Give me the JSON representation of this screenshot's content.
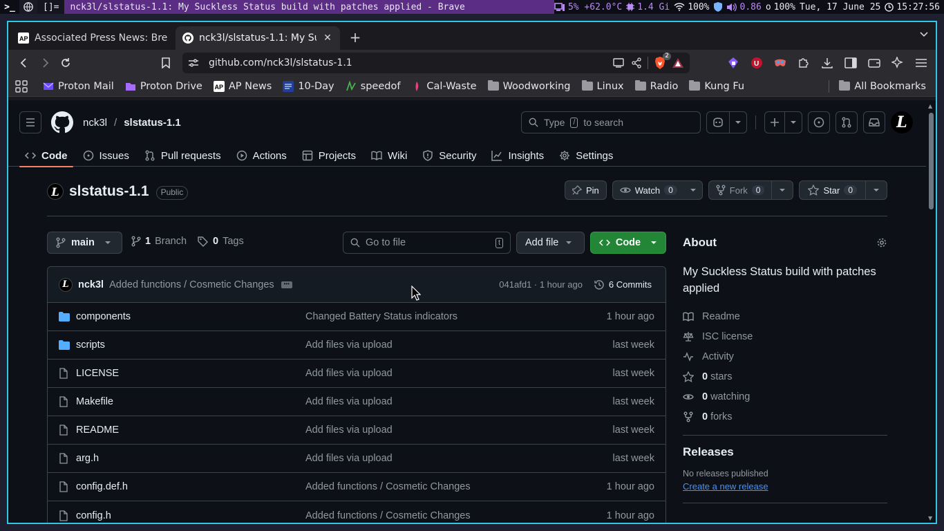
{
  "wm": {
    "terminal_icon": ">_",
    "layout": "[]=",
    "window_title": "nck3l/slstatus-1.1: My Suckless Status build with patches applied - Brave",
    "cpu": "5% +62.0°C",
    "ram": "1.4 Gi",
    "wifi": "100%",
    "volume": "0.86",
    "brightness": "100%",
    "brightness_icon": "o",
    "date": "Tue, 17 June 25",
    "time": "15:27:56"
  },
  "tabs": [
    {
      "title": "Associated Press News: Bre",
      "favicon": "ap-news-icon"
    },
    {
      "title": "nck3l/slstatus-1.1: My Su",
      "favicon": "github-icon",
      "active": true
    }
  ],
  "url": "github.com/nck3l/slstatus-1.1",
  "brave_shield_badge": "2",
  "bookmarks": [
    {
      "label": "Proton Mail",
      "icon": "proton-mail-icon",
      "color": "#6d4aff"
    },
    {
      "label": "Proton Drive",
      "icon": "proton-drive-icon",
      "color": "#a66bff"
    },
    {
      "label": "AP News",
      "icon": "ap-icon",
      "color": "#ffffff"
    },
    {
      "label": "10-Day",
      "icon": "weather-channel-icon",
      "color": "#1f3f9b"
    },
    {
      "label": "speedof",
      "icon": "speedof-icon",
      "color": "#4caf50"
    },
    {
      "label": "Cal-Waste",
      "icon": "cal-waste-icon",
      "color": "#e0457b"
    },
    {
      "label": "Woodworking",
      "icon": "folder-icon"
    },
    {
      "label": "Linux",
      "icon": "folder-icon"
    },
    {
      "label": "Radio",
      "icon": "folder-icon"
    },
    {
      "label": "Kung Fu",
      "icon": "folder-icon"
    }
  ],
  "all_bookmarks": "All Bookmarks",
  "gh": {
    "owner": "nck3l",
    "separator": "/",
    "repo": "slstatus-1.1",
    "search_prefix": "Type",
    "search_key": "/",
    "search_suffix": "to search",
    "avatar_letter": "L",
    "nav": [
      {
        "label": "Code",
        "icon": "code-icon",
        "active": true
      },
      {
        "label": "Issues",
        "icon": "issue-icon"
      },
      {
        "label": "Pull requests",
        "icon": "pull-request-icon"
      },
      {
        "label": "Actions",
        "icon": "play-icon"
      },
      {
        "label": "Projects",
        "icon": "table-icon"
      },
      {
        "label": "Wiki",
        "icon": "book-icon"
      },
      {
        "label": "Security",
        "icon": "shield-icon"
      },
      {
        "label": "Insights",
        "icon": "graph-icon"
      },
      {
        "label": "Settings",
        "icon": "gear-icon"
      }
    ],
    "repo_title": "slstatus-1.1",
    "visibility": "Public",
    "pin": "Pin",
    "watch": "Watch",
    "watch_count": "0",
    "fork": "Fork",
    "fork_count": "0",
    "star": "Star",
    "star_count": "0",
    "branch": "main",
    "branch_count": "1",
    "branch_label": "Branch",
    "tag_count": "0",
    "tag_label": "Tags",
    "goto_placeholder": "Go to file",
    "goto_key": "t",
    "add_file": "Add file",
    "code_btn": "Code",
    "commit": {
      "author": "nck3l",
      "message": "Added functions / Cosmetic Changes",
      "meta": "041afd1 · 1 hour ago",
      "count_label": "6 Commits"
    },
    "files": [
      {
        "name": "components",
        "type": "dir",
        "msg": "Changed Battery Status indicators",
        "time": "1 hour ago"
      },
      {
        "name": "scripts",
        "type": "dir",
        "msg": "Add files via upload",
        "time": "last week"
      },
      {
        "name": "LICENSE",
        "type": "file",
        "msg": "Add files via upload",
        "time": "last week"
      },
      {
        "name": "Makefile",
        "type": "file",
        "msg": "Add files via upload",
        "time": "last week"
      },
      {
        "name": "README",
        "type": "file",
        "msg": "Add files via upload",
        "time": "last week"
      },
      {
        "name": "arg.h",
        "type": "file",
        "msg": "Add files via upload",
        "time": "last week"
      },
      {
        "name": "config.def.h",
        "type": "file",
        "msg": "Added functions / Cosmetic Changes",
        "time": "1 hour ago"
      },
      {
        "name": "config.h",
        "type": "file",
        "msg": "Added functions / Cosmetic Changes",
        "time": "1 hour ago"
      }
    ],
    "about": {
      "title": "About",
      "description": "My Suckless Status build with patches applied",
      "readme": "Readme",
      "license": "ISC license",
      "activity": "Activity",
      "stars_count": "0",
      "stars_label": "stars",
      "watching_count": "0",
      "watching_label": "watching",
      "forks_count": "0",
      "forks_label": "forks"
    },
    "releases": {
      "title": "Releases",
      "none": "No releases published",
      "create": "Create a new release"
    }
  },
  "colors": {
    "accent_border": "#2ec8e6",
    "wm_title_bg": "#5b2d84",
    "gh_bg": "#0d1117",
    "code_button": "#238636",
    "link": "#4493f8",
    "active_tab_underline": "#f78166"
  }
}
